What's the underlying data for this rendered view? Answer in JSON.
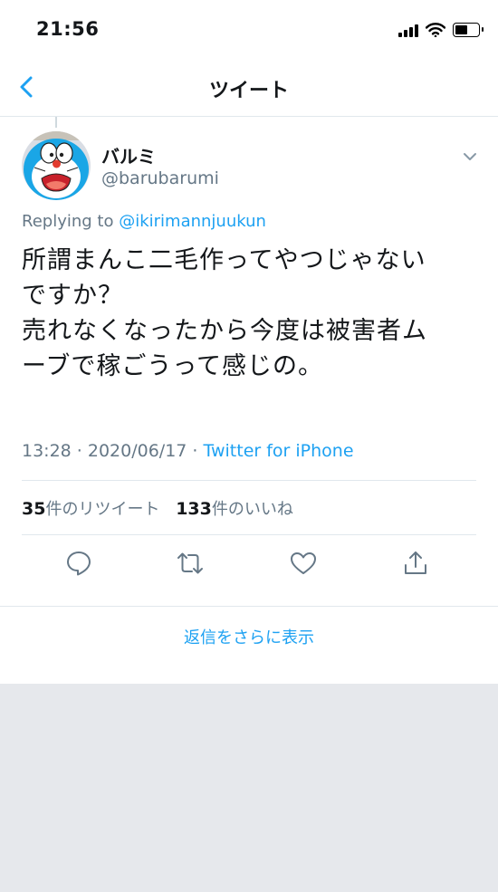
{
  "status_bar": {
    "time": "21:56",
    "battery_level": 0.55
  },
  "nav": {
    "title": "ツイート",
    "back_icon": "chevron-left-icon"
  },
  "tweet": {
    "display_name": "バルミ",
    "handle": "@barubarumi",
    "replying_prefix": "Replying to ",
    "replying_to": "@ikirimannjuukun",
    "text": "所謂まんこ二毛作ってやつじゃない\nですか？\n売れなくなったから今度は被害者ム\nーブで稼ごうって感じの。",
    "timestamp": "13:28 · 2020/06/17 · ",
    "source": "Twitter for iPhone",
    "retweet_count": "35",
    "retweet_label": "件のリツイート",
    "like_count": "133",
    "like_label": "件のいいね"
  },
  "actions": [
    "reply-icon",
    "retweet-icon",
    "like-icon",
    "share-icon"
  ],
  "more_replies": "返信をさらに表示",
  "colors": {
    "accent": "#1da1f2",
    "secondary_text": "#657786",
    "divider": "#e1e8ed",
    "background": "#e6e8ec"
  }
}
